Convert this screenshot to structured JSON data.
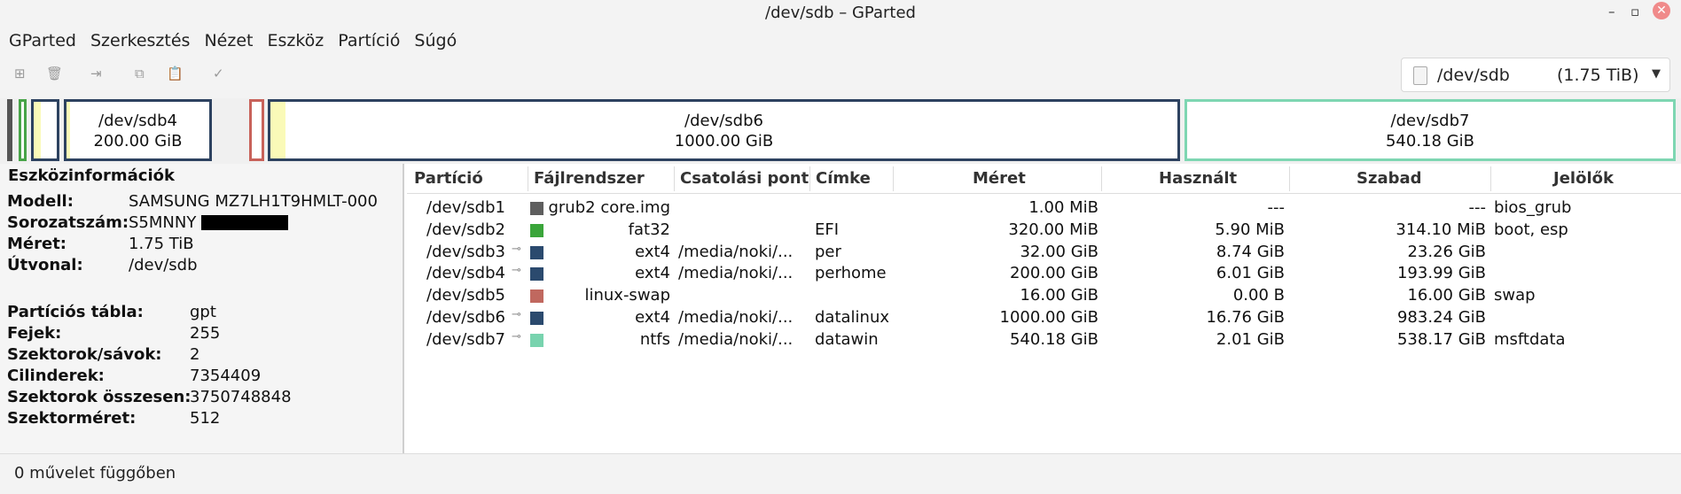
{
  "window": {
    "title": "/dev/sdb – GParted",
    "minimize": "–",
    "maximize": "▫",
    "close": "✕"
  },
  "menu": [
    "GParted",
    "Szerkesztés",
    "Nézet",
    "Eszköz",
    "Partíció",
    "Súgó"
  ],
  "toolbar": {
    "icons": [
      "new-partition-icon",
      "delete-icon",
      "resize-move-icon",
      "copy-icon",
      "paste-icon",
      "apply-icon"
    ],
    "device_name": "/dev/sdb",
    "device_size": "(1.75 TiB)"
  },
  "graph": {
    "segments": [
      {
        "name": "/dev/sdb4",
        "size": "200.00 GiB"
      },
      {
        "name": "/dev/sdb6",
        "size": "1000.00 GiB"
      },
      {
        "name": "/dev/sdb7",
        "size": "540.18 GiB"
      }
    ]
  },
  "info": {
    "title": "Eszközinformációk",
    "device": [
      {
        "k": "Modell:",
        "v": "SAMSUNG MZ7LH1T9HMLT-000"
      },
      {
        "k": "Sorozatszám:",
        "v": "S5MNNY"
      },
      {
        "k": "Méret:",
        "v": "1.75 TiB"
      },
      {
        "k": "Útvonal:",
        "v": "/dev/sdb"
      }
    ],
    "table": [
      {
        "k": "Partíciós tábla:",
        "v": "gpt"
      },
      {
        "k": "Fejek:",
        "v": "255"
      },
      {
        "k": "Szektorok/sávok:",
        "v": "2"
      },
      {
        "k": "Cilinderek:",
        "v": "7354409"
      },
      {
        "k": "Szektorok összesen:",
        "v": "3750748848"
      },
      {
        "k": "Szektorméret:",
        "v": "512"
      }
    ]
  },
  "columns": [
    "Partíció",
    "Fájlrendszer",
    "Csatolási pont",
    "Címke",
    "Méret",
    "Használt",
    "Szabad",
    "Jelölők"
  ],
  "rows": [
    {
      "partition": "/dev/sdb1",
      "fs": "grub2 core.img",
      "color": "#5e5e5e",
      "locked": false,
      "mount": "",
      "label": "",
      "size": "1.00 MiB",
      "used": "---",
      "free": "---",
      "flags": "bios_grub"
    },
    {
      "partition": "/dev/sdb2",
      "fs": "fat32",
      "color": "#3aa53a",
      "locked": false,
      "mount": "",
      "label": "EFI",
      "size": "320.00 MiB",
      "used": "5.90 MiB",
      "free": "314.10 MiB",
      "flags": "boot, esp"
    },
    {
      "partition": "/dev/sdb3",
      "fs": "ext4",
      "color": "#2b4a6e",
      "locked": true,
      "mount": "/media/noki/...",
      "label": "per",
      "size": "32.00 GiB",
      "used": "8.74 GiB",
      "free": "23.26 GiB",
      "flags": ""
    },
    {
      "partition": "/dev/sdb4",
      "fs": "ext4",
      "color": "#2b4a6e",
      "locked": true,
      "mount": "/media/noki/...",
      "label": "perhome",
      "size": "200.00 GiB",
      "used": "6.01 GiB",
      "free": "193.99 GiB",
      "flags": ""
    },
    {
      "partition": "/dev/sdb5",
      "fs": "linux-swap",
      "color": "#c0685f",
      "locked": false,
      "mount": "",
      "label": "",
      "size": "16.00 GiB",
      "used": "0.00 B",
      "free": "16.00 GiB",
      "flags": "swap"
    },
    {
      "partition": "/dev/sdb6",
      "fs": "ext4",
      "color": "#2b4a6e",
      "locked": true,
      "mount": "/media/noki/...",
      "label": "datalinux",
      "size": "1000.00 GiB",
      "used": "16.76 GiB",
      "free": "983.24 GiB",
      "flags": ""
    },
    {
      "partition": "/dev/sdb7",
      "fs": "ntfs",
      "color": "#78d3ae",
      "locked": true,
      "mount": "/media/noki/...",
      "label": "datawin",
      "size": "540.18 GiB",
      "used": "2.01 GiB",
      "free": "538.17 GiB",
      "flags": "msftdata"
    }
  ],
  "status": {
    "text": "0 művelet függőben"
  }
}
